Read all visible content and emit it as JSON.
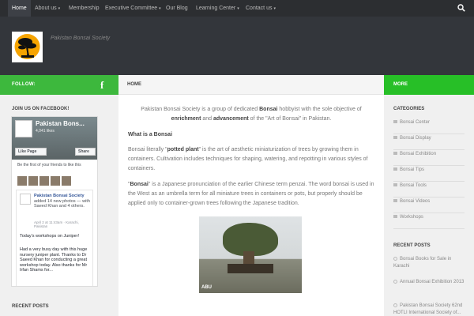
{
  "nav": {
    "items": [
      {
        "label": "Home",
        "caret": false
      },
      {
        "label": "About us",
        "caret": true
      },
      {
        "label": "Membership",
        "caret": false
      },
      {
        "label": "Executive Committee",
        "caret": true
      },
      {
        "label": "Our Blog",
        "caret": false
      },
      {
        "label": "Learning Center",
        "caret": true
      },
      {
        "label": "Contact us",
        "caret": true
      }
    ],
    "caret_glyph": "▾"
  },
  "header": {
    "tagline": "Pakistan Bonsai Society"
  },
  "left_sidebar": {
    "follow_label": "FOLLOW:",
    "fb_icon_glyph": "f",
    "join_title": "JOIN US ON FACEBOOK!",
    "fb": {
      "page_name": "Pakistan Bons...",
      "likes": "4,041 likes",
      "like_button": "Like Page",
      "share_button": "Share",
      "friends_text": "Be the first of your friends to like this",
      "post_author": "Pakistan Bonsai Society",
      "post_action": "added 14 new photos — with Saeed Khan and 4 others.",
      "post_time": "April 2 at 11:43am · Karachi, Pakistan",
      "post_title": "Today's workshops on Juniper!",
      "post_body": "Had a very busy day with this huge nursery juniper plant. Thanks to Dr Saeed Khan for conducting a great workshop today. Also thanks for Mr Irfan Shams for..."
    },
    "recent_title": "RECENT POSTS"
  },
  "main": {
    "crumb": "HOME",
    "intro": {
      "a": "Pakistan Bonsai Society is a group of dedicated ",
      "b": "Bonsai",
      "c": " hobbyist with the sole objective of ",
      "d": "enrichment",
      "e": " and ",
      "f": "advancement",
      "g": " of the \"Art of Bonsai\" in Pakistan."
    },
    "what_heading": "What is a Bonsai",
    "literal": {
      "a": "Bonsai literally \"",
      "b": "potted plant",
      "c": "\" is the art of aesthetic miniaturization of trees by growing them in containers. Cultivation includes techniques for shaping, watering, and repotting in various styles of containers."
    },
    "bonsai": {
      "a": "\"",
      "b": "Bonsai",
      "c": "\" is a Japanese pronunciation of the earlier Chinese term penzai. The word bonsai is used in the West as an umbrella term for all miniature trees in containers or pots, but properly should be applied only to container-grown trees following the Japanese tradition."
    },
    "photo_mark": "ABU"
  },
  "right_sidebar": {
    "more_label": "MORE",
    "categories_title": "CATEGORIES",
    "categories": [
      "Bonsai Center",
      "Bonsai Display",
      "Bonsai Exhibition",
      "Bonsai Tips",
      "Bonsai Tools",
      "Bonsai Videos",
      "Workshops"
    ],
    "recent_title": "RECENT POSTS",
    "posts": [
      "Bonsai Books for Sale in Karachi",
      "Annual Bonsai Exhibition 2013",
      "Pakistan Bonsai Society 62nd HOTLI International Society of..."
    ]
  },
  "colors": {
    "green": "#3db83d",
    "nav_bg": "#2c2e31",
    "header_bg": "#33363b"
  }
}
